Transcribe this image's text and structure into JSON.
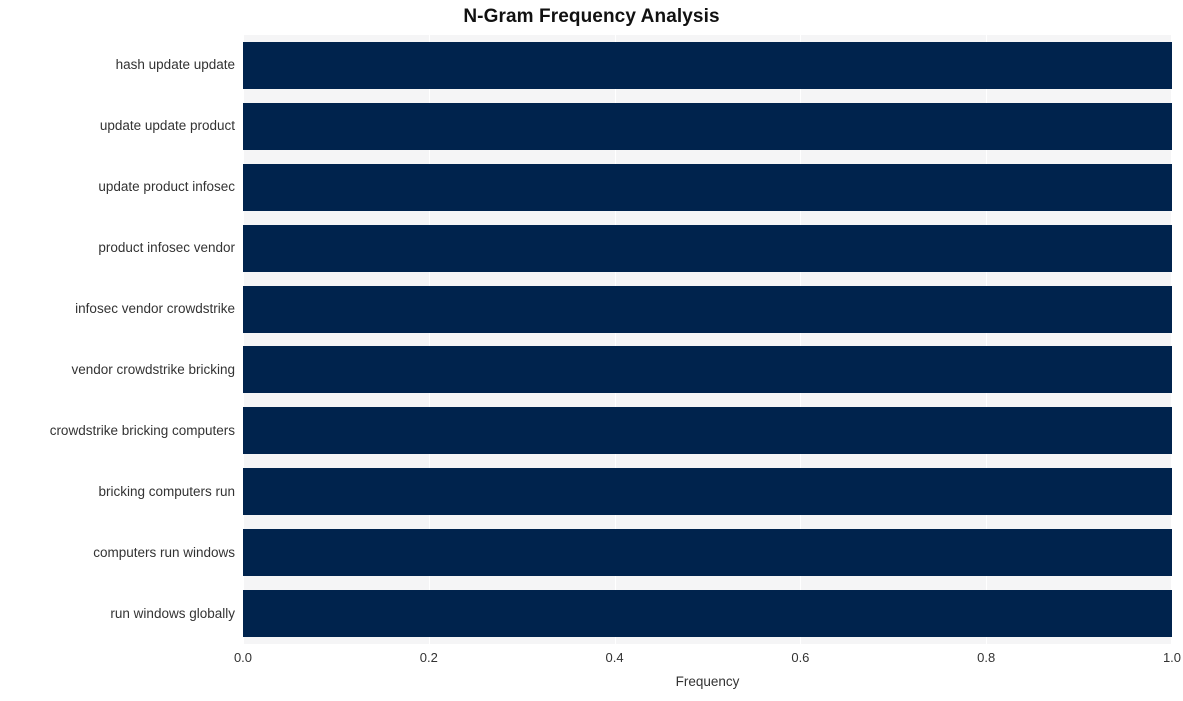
{
  "chart_data": {
    "type": "bar",
    "orientation": "horizontal",
    "title": "N-Gram Frequency Analysis",
    "xlabel": "Frequency",
    "ylabel": "",
    "categories": [
      "hash update update",
      "update update product",
      "update product infosec",
      "product infosec vendor",
      "infosec vendor crowdstrike",
      "vendor crowdstrike bricking",
      "crowdstrike bricking computers",
      "bricking computers run",
      "computers run windows",
      "run windows globally"
    ],
    "values": [
      1.0,
      1.0,
      1.0,
      1.0,
      1.0,
      1.0,
      1.0,
      1.0,
      1.0,
      1.0
    ],
    "xlim": [
      0.0,
      1.0
    ],
    "xticks": [
      "0.0",
      "0.2",
      "0.4",
      "0.6",
      "0.8",
      "1.0"
    ],
    "xtick_values": [
      0.0,
      0.2,
      0.4,
      0.6,
      0.8,
      1.0
    ],
    "grid": true,
    "grid_axis": "x",
    "legend": null,
    "bar_color": "#00234d",
    "plot_background": "#f5f5f6",
    "grid_color": "#ffffff",
    "text_color": "#333333",
    "title_color": "#111111"
  }
}
